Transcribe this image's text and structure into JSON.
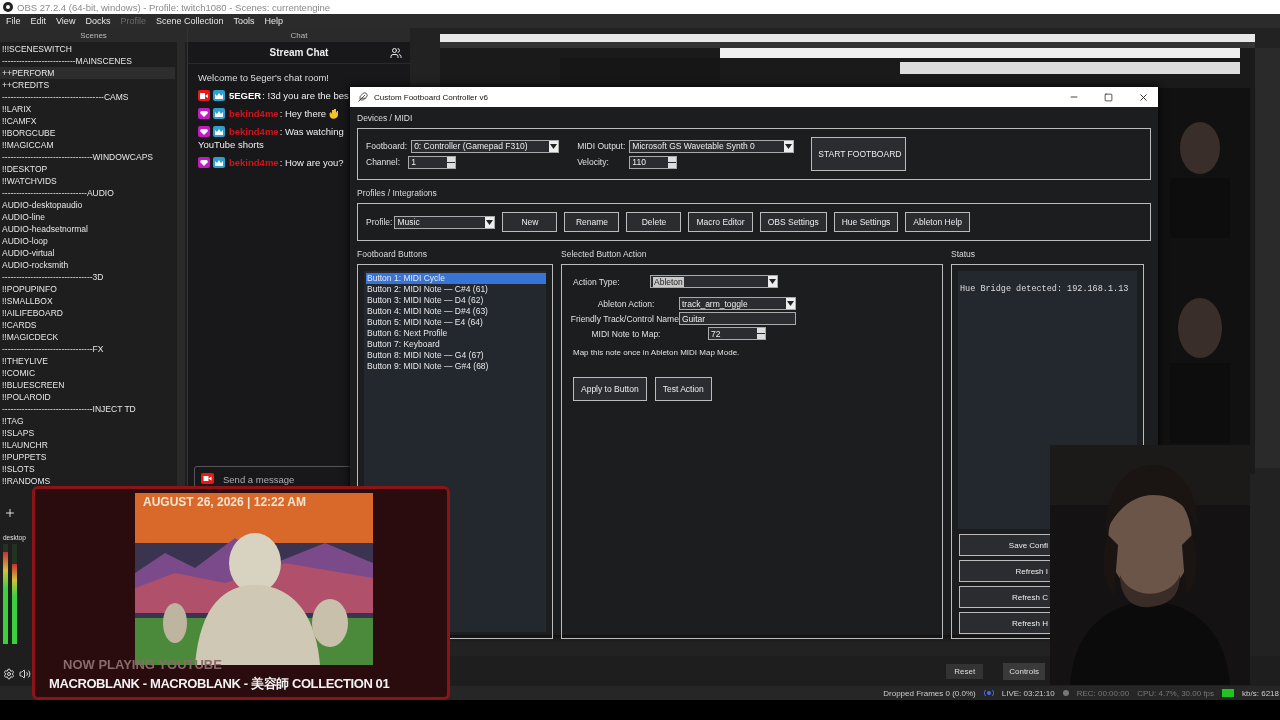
{
  "obs": {
    "title": "OBS 27.2.4 (64-bit, windows) - Profile: twitch1080 - Scenes: currentengine",
    "menu": [
      {
        "label": "File",
        "disabled": false
      },
      {
        "label": "Edit",
        "disabled": false
      },
      {
        "label": "View",
        "disabled": false
      },
      {
        "label": "Docks",
        "disabled": false
      },
      {
        "label": "Profile",
        "disabled": true
      },
      {
        "label": "Scene Collection",
        "disabled": false
      },
      {
        "label": "Tools",
        "disabled": false
      },
      {
        "label": "Help",
        "disabled": false
      }
    ],
    "scenes_dock": {
      "title": "Scenes",
      "items": [
        {
          "label": "!!!SCENESWITCH",
          "selected": false
        },
        {
          "label": "--------------------------MAINSCENES",
          "selected": false
        },
        {
          "label": "++PERFORM",
          "selected": true
        },
        {
          "label": "++CREDITS",
          "selected": false
        },
        {
          "label": "------------------------------------CAMS",
          "selected": false
        },
        {
          "label": "!!LARIX",
          "selected": false
        },
        {
          "label": "!!CAMFX",
          "selected": false
        },
        {
          "label": "!!BORGCUBE",
          "selected": false
        },
        {
          "label": "!!MAGICCAM",
          "selected": false
        },
        {
          "label": "--------------------------------WINDOWCAPS",
          "selected": false
        },
        {
          "label": "!!DESKTOP",
          "selected": false
        },
        {
          "label": "!!WATCHVIDS",
          "selected": false
        },
        {
          "label": "------------------------------AUDIO",
          "selected": false
        },
        {
          "label": "AUDIO-desktopaudio",
          "selected": false
        },
        {
          "label": "AUDIO-line",
          "selected": false
        },
        {
          "label": "AUDIO-headsetnormal",
          "selected": false
        },
        {
          "label": "AUDIO-loop",
          "selected": false
        },
        {
          "label": "AUDIO-virtual",
          "selected": false
        },
        {
          "label": "AUDIO-rocksmith",
          "selected": false
        },
        {
          "label": "--------------------------------3D",
          "selected": false
        },
        {
          "label": "!!POPUPINFO",
          "selected": false
        },
        {
          "label": "!!SMALLBOX",
          "selected": false
        },
        {
          "label": "!!AILIFEBOARD",
          "selected": false
        },
        {
          "label": "!!CARDS",
          "selected": false
        },
        {
          "label": "!!MAGICDECK",
          "selected": false
        },
        {
          "label": "--------------------------------FX",
          "selected": false
        },
        {
          "label": "!!THEYLIVE",
          "selected": false
        },
        {
          "label": "!!COMIC",
          "selected": false
        },
        {
          "label": "!!BLUESCREEN",
          "selected": false
        },
        {
          "label": "!!POLAROID",
          "selected": false
        },
        {
          "label": "--------------------------------INJECT TD",
          "selected": false
        },
        {
          "label": "!!TAG",
          "selected": false
        },
        {
          "label": "!!SLAPS",
          "selected": false
        },
        {
          "label": "!!LAUNCHR",
          "selected": false
        },
        {
          "label": "!!PUPPETS",
          "selected": false
        },
        {
          "label": "!!SLOTS",
          "selected": false
        },
        {
          "label": "!!RANDOMS",
          "selected": false
        }
      ]
    },
    "chat_dock": {
      "title": "Chat",
      "header": "Stream Chat",
      "welcome": "Welcome to 5eger's chat room!",
      "messages": [
        {
          "badges": [
            {
              "kind": "broadcaster"
            },
            {
              "kind": "subscriber"
            }
          ],
          "user": "5EGER",
          "color": "#ffffff",
          "text": ": !3d you are the bes",
          "wave": false
        },
        {
          "badges": [
            {
              "kind": "gem"
            },
            {
              "kind": "subscriber"
            }
          ],
          "user": "bekind4me",
          "color": "#d0141a",
          "text": ": Hey there",
          "wave": true
        },
        {
          "badges": [
            {
              "kind": "gem"
            },
            {
              "kind": "subscriber"
            }
          ],
          "user": "bekind4me",
          "color": "#d0141a",
          "text": ": Was watching",
          "continuation": "YouTube shorts",
          "wave": false
        },
        {
          "badges": [
            {
              "kind": "gem"
            },
            {
              "kind": "subscriber"
            }
          ],
          "user": "bekind4me",
          "color": "#d0141a",
          "text": ": How are you?",
          "wave": false
        }
      ],
      "input": {
        "placeholder": "Send a message"
      }
    },
    "mixer": {
      "label": "desktop",
      "meters": [
        {
          "level": 0.92
        },
        {
          "level": 0.8
        }
      ]
    },
    "controls": {
      "reset": "Reset",
      "tab": "Controls"
    },
    "status_bar": {
      "dropped": "Dropped Frames 0 (0.0%)",
      "live": "LIVE: 03:21:10",
      "rec": "REC: 00:00:00",
      "cpu": "CPU: 4.7%, 30.00 fps",
      "bitrate": "kb/s: 6218"
    }
  },
  "footboard_window": {
    "title": "Custom Footboard Controller v6",
    "devices": {
      "title": "Devices / MIDI",
      "footboard_label": "Footboard:",
      "footboard": "0: Controller (Gamepad F310)",
      "midi_output_label": "MIDI Output:",
      "midi_output": "Microsoft GS Wavetable Synth 0",
      "channel_label": "Channel:",
      "channel": "1",
      "velocity_label": "Velocity:",
      "velocity": "110",
      "start_button": "START FOOTBOARD"
    },
    "profiles": {
      "title": "Profiles / Integrations",
      "profile_label": "Profile:",
      "profile": "Music",
      "buttons": [
        "New",
        "Rename",
        "Delete",
        "Macro Editor",
        "OBS Settings",
        "Hue Settings",
        "Ableton Help"
      ]
    },
    "buttons_panel": {
      "title": "Footboard Buttons",
      "items": [
        {
          "label": "Button 1: MIDI Cycle",
          "selected": true
        },
        {
          "label": "Button 2: MIDI Note — C#4 (61)",
          "selected": false
        },
        {
          "label": "Button 3: MIDI Note — D4 (62)",
          "selected": false
        },
        {
          "label": "Button 4: MIDI Note — D#4 (63)",
          "selected": false
        },
        {
          "label": "Button 5: MIDI Note — E4 (64)",
          "selected": false
        },
        {
          "label": "Button 6: Next Profile",
          "selected": false
        },
        {
          "label": "Button 7: Keyboard",
          "selected": false
        },
        {
          "label": "Button 8: MIDI Note — G4 (67)",
          "selected": false
        },
        {
          "label": "Button 9: MIDI Note — G#4 (68)",
          "selected": false
        }
      ]
    },
    "action_panel": {
      "title": "Selected Button Action",
      "action_type_label": "Action Type:",
      "action_type": {
        "value": "Ableton",
        "highlighted": true
      },
      "fields": [
        {
          "kind": "combo",
          "label": "Ableton Action:",
          "value": "track_arm_toggle"
        },
        {
          "kind": "text",
          "label": "Friendly Track/Control Name:",
          "value": "Guitar"
        },
        {
          "kind": "spin",
          "label": "MIDI Note to Map:",
          "value": "72"
        }
      ],
      "hint": "Map this note once in Ableton MIDI Map Mode.",
      "buttons": [
        "Apply to Button",
        "Test Action"
      ]
    },
    "status_panel": {
      "title": "Status",
      "log": "Hue Bridge detected: 192.168.1.13",
      "buttons": [
        "Save Confi",
        "Refresh I",
        "Refresh C",
        "Refresh H"
      ]
    }
  },
  "overlay": {
    "date": "AUGUST 26, 2026 | 12:22 AM",
    "now_playing": "NOW PLAYING YOUTUBE",
    "track": "MACROBLANK - MACROBLANK - 美容師 COLLECTION 01"
  }
}
